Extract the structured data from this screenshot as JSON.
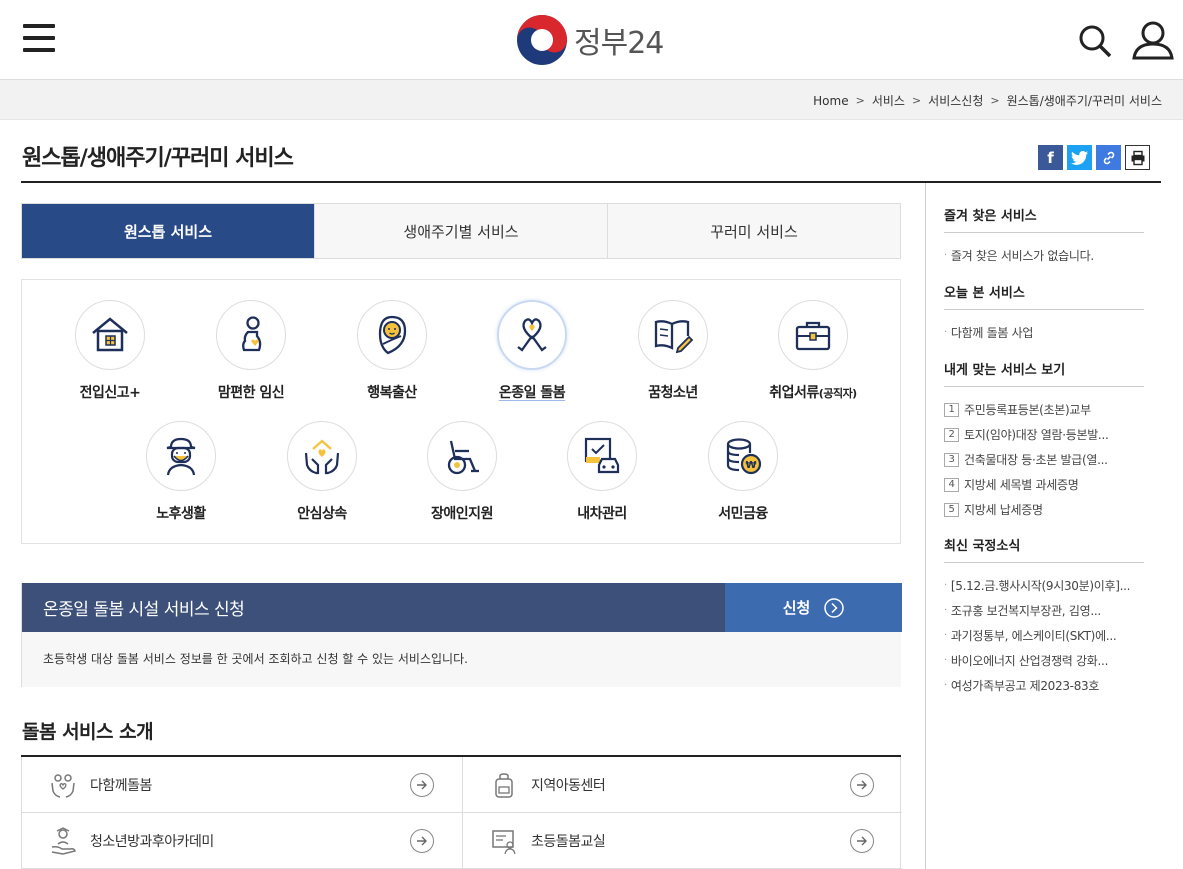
{
  "header": {
    "logo_text": "정부24"
  },
  "breadcrumb": [
    "Home",
    "서비스",
    "서비스신청",
    "원스톱/생애주기/꾸러미 서비스"
  ],
  "page_title": "원스톱/생애주기/꾸러미 서비스",
  "share": {
    "facebook": "f",
    "link": "🔗",
    "print": "🖶"
  },
  "tabs": [
    {
      "label": "원스톱 서비스",
      "active": true
    },
    {
      "label": "생애주기별 서비스",
      "active": false
    },
    {
      "label": "꾸러미 서비스",
      "active": false
    }
  ],
  "services_row1": [
    {
      "label": "전입신고+",
      "icon": "house-icon"
    },
    {
      "label": "맘편한 임신",
      "icon": "pregnant-icon"
    },
    {
      "label": "행복출산",
      "icon": "baby-icon"
    },
    {
      "label": "온종일 돌봄",
      "icon": "ribbon-heart-icon",
      "selected": true
    },
    {
      "label": "꿈청소년",
      "icon": "book-pen-icon"
    },
    {
      "label": "취업서류",
      "label_small": "(공직자)",
      "icon": "briefcase-icon"
    }
  ],
  "services_row2": [
    {
      "label": "노후생활",
      "icon": "elder-icon"
    },
    {
      "label": "안심상속",
      "icon": "hands-house-icon"
    },
    {
      "label": "장애인지원",
      "icon": "wheelchair-icon"
    },
    {
      "label": "내차관리",
      "icon": "car-document-icon"
    },
    {
      "label": "서민금융",
      "icon": "coins-icon"
    }
  ],
  "apply": {
    "title": "온종일 돌봄 시설 서비스 신청",
    "button": "신청",
    "description": "초등학생 대상 돌봄 서비스 정보를 한 곳에서 조회하고 신청 할 수 있는 서비스입니다."
  },
  "intro": {
    "title": "돌봄 서비스 소개",
    "items": [
      {
        "label": "다함께돌봄",
        "icon": "care-hands-icon"
      },
      {
        "label": "지역아동센터",
        "icon": "backpack-icon"
      },
      {
        "label": "청소년방과후아카데미",
        "icon": "student-hand-icon"
      },
      {
        "label": "초등돌봄교실",
        "icon": "classroom-icon"
      }
    ]
  },
  "sidebar": {
    "favorites": {
      "title": "즐겨 찾은 서비스",
      "items": [
        "즐겨 찾은 서비스가 없습니다."
      ]
    },
    "today": {
      "title": "오늘 본 서비스",
      "items": [
        "다함께 돌봄 사업"
      ]
    },
    "recommended": {
      "title": "내게 맞는 서비스 보기",
      "items": [
        "주민등록표등본(초본)교부",
        "토지(임야)대장 열람·등본발...",
        "건축물대장 등·초본 발급(열...",
        "지방세 세목별 과세증명",
        "지방세 납세증명"
      ]
    },
    "news": {
      "title": "최신 국정소식",
      "items": [
        "[5.12.금.행사시작(9시30분)이후]...",
        "조규홍 보건복지부장관, 김영...",
        "과기정통부, 에스케이티(SKT)에...",
        "바이오에너지 산업경쟁력 강화...",
        "여성가족부공고 제2023-83호"
      ]
    }
  },
  "colors": {
    "primary": "#284a87",
    "apply_head": "#3d5079",
    "apply_btn": "#3c6bb0",
    "icon_gold": "#f5c33b",
    "icon_navy": "#1e2f5a"
  }
}
